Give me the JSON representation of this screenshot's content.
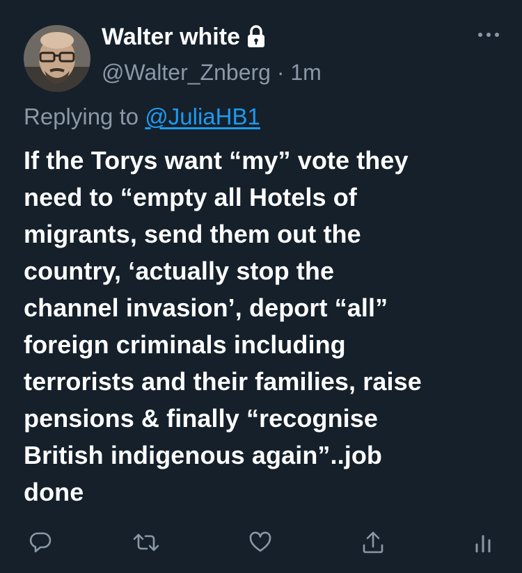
{
  "author": {
    "display_name": "Walter white",
    "handle": "@Walter_Znberg",
    "separator": "·",
    "time": "1m",
    "protected_icon": "lock-icon"
  },
  "reply": {
    "prefix": "Replying to ",
    "mention": "@JuliaHB1"
  },
  "tweet_lines": [
    "If the Torys want “my” vote they",
    "need to “empty all Hotels of",
    "migrants, send them out the",
    "country, ‘actually stop the",
    "channel invasion’, deport “all”",
    "foreign criminals including",
    "terrorists and their families, raise",
    "pensions & finally “recognise",
    "British indigenous again”..job",
    "done"
  ],
  "actions": [
    "reply-icon",
    "retweet-icon",
    "like-icon",
    "share-icon",
    "analytics-icon"
  ],
  "colors": {
    "background": "#15202b",
    "text": "#ffffff",
    "secondary": "#8b98a5",
    "accent": "#1d9bf0"
  }
}
